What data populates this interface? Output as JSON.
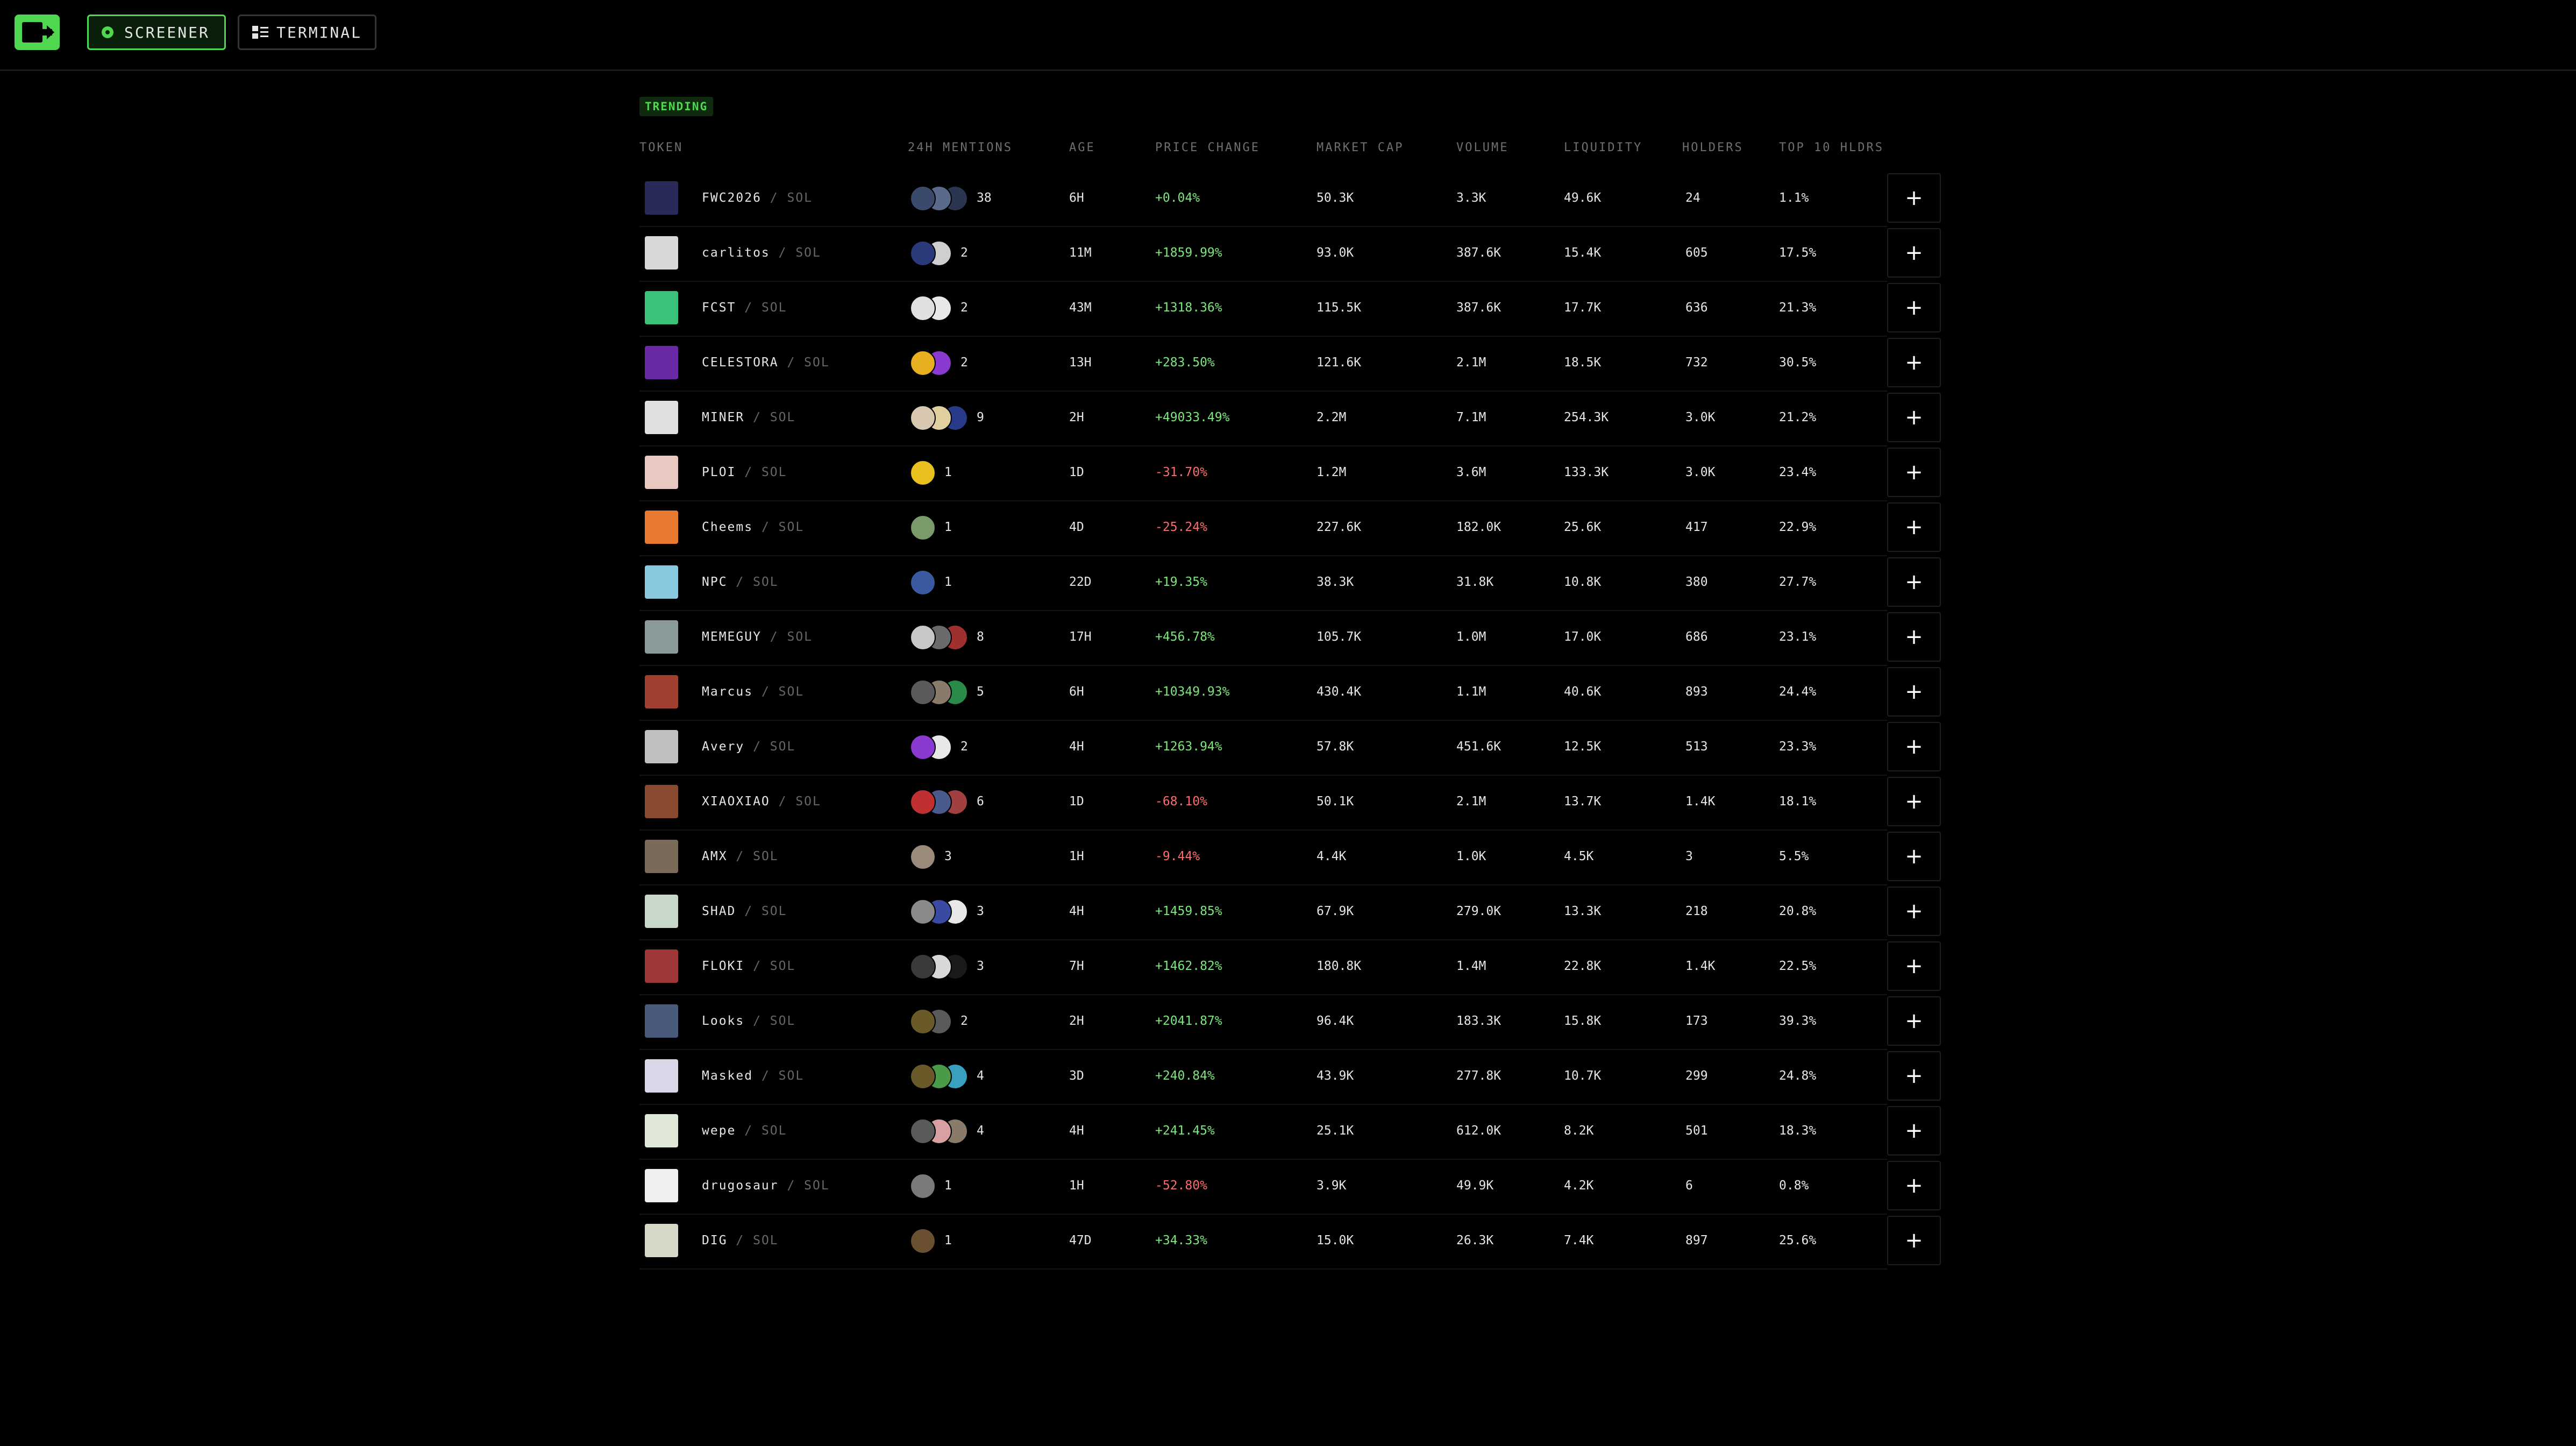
{
  "nav": {
    "screener_label": "SCREENER",
    "terminal_label": "TERMINAL"
  },
  "section_label": "TRENDING",
  "columns": [
    "TOKEN",
    "24H MENTIONS",
    "AGE",
    "PRICE CHANGE",
    "MARKET CAP",
    "VOLUME",
    "LIQUIDITY",
    "HOLDERS",
    "TOP 10 HLDRS"
  ],
  "add_label": "+",
  "pair_separator": "/",
  "rows": [
    {
      "symbol": "FWC2026",
      "chain": "SOL",
      "mentions": "38",
      "age": "6H",
      "change": "+0.04%",
      "change_dir": "up",
      "mcap": "50.3K",
      "volume": "3.3K",
      "liquidity": "49.6K",
      "holders": "24",
      "top10": "1.1%",
      "icon_color": "#2a2a5a",
      "avatar_colors": [
        "#3a4a6a",
        "#5a6a8a",
        "#2a3550"
      ]
    },
    {
      "symbol": "carlitos",
      "chain": "SOL",
      "mentions": "2",
      "age": "11M",
      "change": "+1859.99%",
      "change_dir": "up",
      "mcap": "93.0K",
      "volume": "387.6K",
      "liquidity": "15.4K",
      "holders": "605",
      "top10": "17.5%",
      "icon_color": "#d8d8d8",
      "avatar_colors": [
        "#2a3a7a",
        "#cfcfcf"
      ]
    },
    {
      "symbol": "FCST",
      "chain": "SOL",
      "mentions": "2",
      "age": "43M",
      "change": "+1318.36%",
      "change_dir": "up",
      "mcap": "115.5K",
      "volume": "387.6K",
      "liquidity": "17.7K",
      "holders": "636",
      "top10": "21.3%",
      "icon_color": "#3ac27a",
      "avatar_colors": [
        "#e0e0e0",
        "#e8e8e8"
      ]
    },
    {
      "symbol": "CELESTORA",
      "chain": "SOL",
      "mentions": "2",
      "age": "13H",
      "change": "+283.50%",
      "change_dir": "up",
      "mcap": "121.6K",
      "volume": "2.1M",
      "liquidity": "18.5K",
      "holders": "732",
      "top10": "30.5%",
      "icon_color": "#6a2aa8",
      "avatar_colors": [
        "#e8b020",
        "#8a3ad0"
      ]
    },
    {
      "symbol": "MINER",
      "chain": "SOL",
      "mentions": "9",
      "age": "2H",
      "change": "+49033.49%",
      "change_dir": "up",
      "mcap": "2.2M",
      "volume": "7.1M",
      "liquidity": "254.3K",
      "holders": "3.0K",
      "top10": "21.2%",
      "icon_color": "#e0e0e0",
      "avatar_colors": [
        "#d8c8b0",
        "#e0d0a0",
        "#2a3a8a"
      ]
    },
    {
      "symbol": "PLOI",
      "chain": "SOL",
      "mentions": "1",
      "age": "1D",
      "change": "-31.70%",
      "change_dir": "down",
      "mcap": "1.2M",
      "volume": "3.6M",
      "liquidity": "133.3K",
      "holders": "3.0K",
      "top10": "23.4%",
      "icon_color": "#e8c8c0",
      "avatar_colors": [
        "#e8c020"
      ]
    },
    {
      "symbol": "Cheems",
      "chain": "SOL",
      "mentions": "1",
      "age": "4D",
      "change": "-25.24%",
      "change_dir": "down",
      "mcap": "227.6K",
      "volume": "182.0K",
      "liquidity": "25.6K",
      "holders": "417",
      "top10": "22.9%",
      "icon_color": "#e87a30",
      "avatar_colors": [
        "#7a9a6a"
      ]
    },
    {
      "symbol": "NPC",
      "chain": "SOL",
      "mentions": "1",
      "age": "22D",
      "change": "+19.35%",
      "change_dir": "up",
      "mcap": "38.3K",
      "volume": "31.8K",
      "liquidity": "10.8K",
      "holders": "380",
      "top10": "27.7%",
      "icon_color": "#8ac8e0",
      "avatar_colors": [
        "#3a5aa0"
      ]
    },
    {
      "symbol": "MEMEGUY",
      "chain": "SOL",
      "mentions": "8",
      "age": "17H",
      "change": "+456.78%",
      "change_dir": "up",
      "mcap": "105.7K",
      "volume": "1.0M",
      "liquidity": "17.0K",
      "holders": "686",
      "top10": "23.1%",
      "icon_color": "#8a9a9a",
      "avatar_colors": [
        "#c8c8c8",
        "#6a6a6a",
        "#a03030"
      ]
    },
    {
      "symbol": "Marcus",
      "chain": "SOL",
      "mentions": "5",
      "age": "6H",
      "change": "+10349.93%",
      "change_dir": "up",
      "mcap": "430.4K",
      "volume": "1.1M",
      "liquidity": "40.6K",
      "holders": "893",
      "top10": "24.4%",
      "icon_color": "#a04030",
      "avatar_colors": [
        "#5a5a5a",
        "#8a7a6a",
        "#2a8a4a"
      ]
    },
    {
      "symbol": "Avery",
      "chain": "SOL",
      "mentions": "2",
      "age": "4H",
      "change": "+1263.94%",
      "change_dir": "up",
      "mcap": "57.8K",
      "volume": "451.6K",
      "liquidity": "12.5K",
      "holders": "513",
      "top10": "23.3%",
      "icon_color": "#c0c0c0",
      "avatar_colors": [
        "#8a3ad0",
        "#e8e8e8"
      ]
    },
    {
      "symbol": "XIAOXIAO",
      "chain": "SOL",
      "mentions": "6",
      "age": "1D",
      "change": "-68.10%",
      "change_dir": "down",
      "mcap": "50.1K",
      "volume": "2.1M",
      "liquidity": "13.7K",
      "holders": "1.4K",
      "top10": "18.1%",
      "icon_color": "#8a4a30",
      "avatar_colors": [
        "#c03030",
        "#4a5a8a",
        "#a04040"
      ]
    },
    {
      "symbol": "AMX",
      "chain": "SOL",
      "mentions": "3",
      "age": "1H",
      "change": "-9.44%",
      "change_dir": "down",
      "mcap": "4.4K",
      "volume": "1.0K",
      "liquidity": "4.5K",
      "holders": "3",
      "top10": "5.5%",
      "icon_color": "#7a6a5a",
      "avatar_colors": [
        "#9a8a7a"
      ]
    },
    {
      "symbol": "SHAD",
      "chain": "SOL",
      "mentions": "3",
      "age": "4H",
      "change": "+1459.85%",
      "change_dir": "up",
      "mcap": "67.9K",
      "volume": "279.0K",
      "liquidity": "13.3K",
      "holders": "218",
      "top10": "20.8%",
      "icon_color": "#c8d8c8",
      "avatar_colors": [
        "#8a8a8a",
        "#3a4aa0",
        "#e8e8e8"
      ]
    },
    {
      "symbol": "FLOKI",
      "chain": "SOL",
      "mentions": "3",
      "age": "7H",
      "change": "+1462.82%",
      "change_dir": "up",
      "mcap": "180.8K",
      "volume": "1.4M",
      "liquidity": "22.8K",
      "holders": "1.4K",
      "top10": "22.5%",
      "icon_color": "#a03838",
      "avatar_colors": [
        "#3a3a3a",
        "#d8d8d8",
        "#1a1a1a"
      ]
    },
    {
      "symbol": "Looks",
      "chain": "SOL",
      "mentions": "2",
      "age": "2H",
      "change": "+2041.87%",
      "change_dir": "up",
      "mcap": "96.4K",
      "volume": "183.3K",
      "liquidity": "15.8K",
      "holders": "173",
      "top10": "39.3%",
      "icon_color": "#4a5a7a",
      "avatar_colors": [
        "#6a5a2a",
        "#5a5a5a"
      ]
    },
    {
      "symbol": "Masked",
      "chain": "SOL",
      "mentions": "4",
      "age": "3D",
      "change": "+240.84%",
      "change_dir": "up",
      "mcap": "43.9K",
      "volume": "277.8K",
      "liquidity": "10.7K",
      "holders": "299",
      "top10": "24.8%",
      "icon_color": "#d8d8e8",
      "avatar_colors": [
        "#6a5a2a",
        "#4a9a4a",
        "#3aa0c0"
      ]
    },
    {
      "symbol": "wepe",
      "chain": "SOL",
      "mentions": "4",
      "age": "4H",
      "change": "+241.45%",
      "change_dir": "up",
      "mcap": "25.1K",
      "volume": "612.0K",
      "liquidity": "8.2K",
      "holders": "501",
      "top10": "18.3%",
      "icon_color": "#e0e8d8",
      "avatar_colors": [
        "#5a5a5a",
        "#d8a0a0",
        "#8a7a6a"
      ]
    },
    {
      "symbol": "drugosaur",
      "chain": "SOL",
      "mentions": "1",
      "age": "1H",
      "change": "-52.80%",
      "change_dir": "down",
      "mcap": "3.9K",
      "volume": "49.9K",
      "liquidity": "4.2K",
      "holders": "6",
      "top10": "0.8%",
      "icon_color": "#f0f0f0",
      "avatar_colors": [
        "#7a7a7a"
      ]
    },
    {
      "symbol": "DIG",
      "chain": "SOL",
      "mentions": "1",
      "age": "47D",
      "change": "+34.33%",
      "change_dir": "up",
      "mcap": "15.0K",
      "volume": "26.3K",
      "liquidity": "7.4K",
      "holders": "897",
      "top10": "25.6%",
      "icon_color": "#d8d8c8",
      "avatar_colors": [
        "#6a5030"
      ]
    }
  ]
}
